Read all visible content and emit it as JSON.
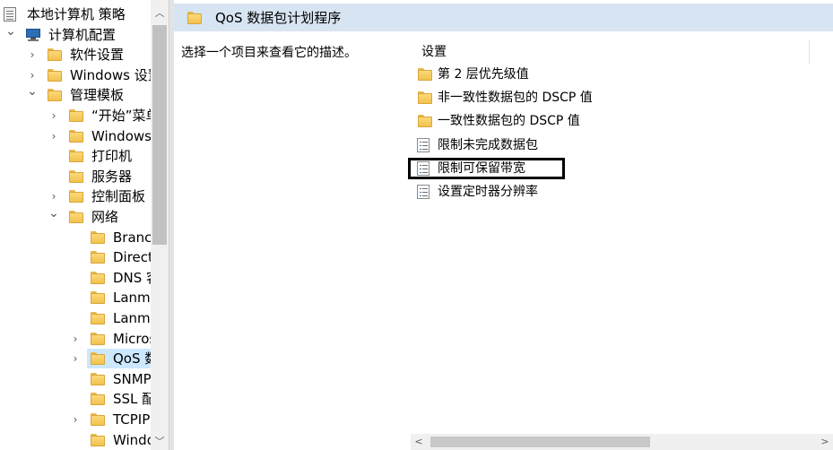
{
  "tree": {
    "items": [
      {
        "label": "本地计算机 策略",
        "icon": "policy-doc-icon",
        "arrow": ""
      },
      {
        "label": "计算机配置",
        "icon": "computer-icon",
        "arrow": "expanded"
      },
      {
        "label": "软件设置",
        "icon": "folder-icon",
        "arrow": "collapsed"
      },
      {
        "label": "Windows 设置",
        "icon": "folder-icon",
        "arrow": "collapsed"
      },
      {
        "label": "管理模板",
        "icon": "folder-icon",
        "arrow": "expanded"
      },
      {
        "label": "“开始”菜单",
        "icon": "folder-icon",
        "arrow": "collapsed"
      },
      {
        "label": "Windows 组件",
        "icon": "folder-icon",
        "arrow": "collapsed"
      },
      {
        "label": "打印机",
        "icon": "folder-icon",
        "arrow": ""
      },
      {
        "label": "服务器",
        "icon": "folder-icon",
        "arrow": ""
      },
      {
        "label": "控制面板",
        "icon": "folder-icon",
        "arrow": "collapsed"
      },
      {
        "label": "网络",
        "icon": "folder-icon",
        "arrow": "expanded"
      },
      {
        "label": "BranchCache",
        "icon": "folder-icon",
        "arrow": ""
      },
      {
        "label": "DirectAccess",
        "icon": "folder-icon",
        "arrow": ""
      },
      {
        "label": "DNS 客户端",
        "icon": "folder-icon",
        "arrow": ""
      },
      {
        "label": "Lanman 服务器",
        "icon": "folder-icon",
        "arrow": ""
      },
      {
        "label": "Lanman 工作站",
        "icon": "folder-icon",
        "arrow": ""
      },
      {
        "label": "Microsoft",
        "icon": "folder-icon",
        "arrow": "collapsed"
      },
      {
        "label": "QoS 数据包",
        "icon": "folder-open-icon",
        "arrow": "collapsed",
        "selected": true
      },
      {
        "label": "SNMP",
        "icon": "folder-icon",
        "arrow": ""
      },
      {
        "label": "SSL 配置",
        "icon": "folder-icon",
        "arrow": ""
      },
      {
        "label": "TCPIP",
        "icon": "folder-icon",
        "arrow": "collapsed"
      },
      {
        "label": "Windows",
        "icon": "folder-icon",
        "arrow": ""
      }
    ]
  },
  "right": {
    "title": "QoS 数据包计划程序",
    "description": "选择一个项目来查看它的描述。",
    "column_header": "设置",
    "items": [
      {
        "label": "第 2 层优先级值",
        "icon": "folder-icon"
      },
      {
        "label": "非一致性数据包的 DSCP 值",
        "icon": "folder-icon"
      },
      {
        "label": "一致性数据包的 DSCP 值",
        "icon": "folder-icon"
      },
      {
        "label": "限制未完成数据包",
        "icon": "setting-icon"
      },
      {
        "label": "限制可保留带宽",
        "icon": "setting-icon",
        "focused": true
      },
      {
        "label": "设置定时器分辨率",
        "icon": "setting-icon"
      }
    ]
  },
  "colors": {
    "header_bg": "#d7e4f2",
    "selection_bg": "#cce8ff",
    "folder_yellow": "#f2c24e"
  }
}
